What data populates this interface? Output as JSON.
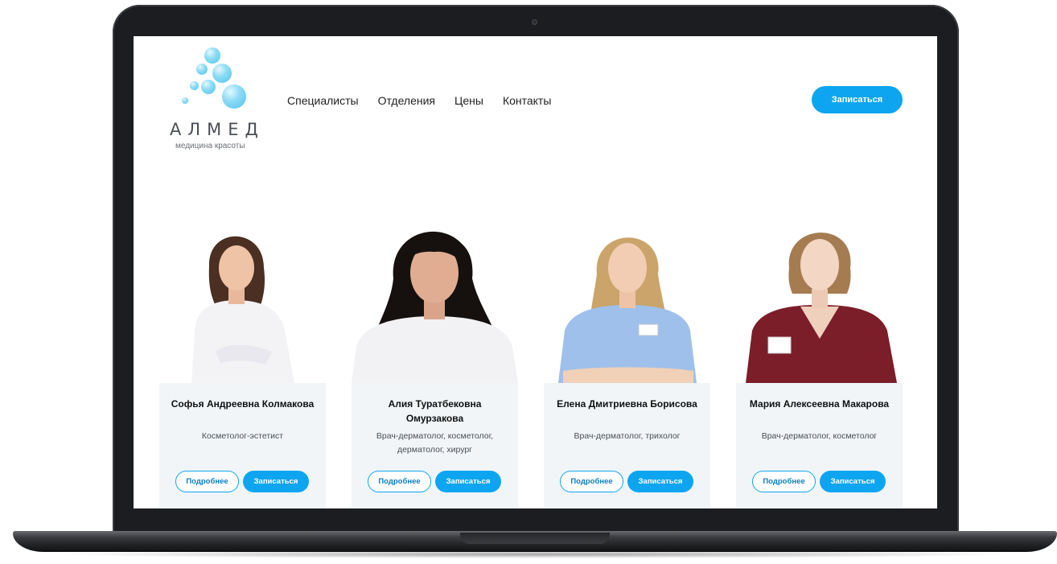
{
  "brand": {
    "name": "АЛМЕД",
    "tagline": "медицина красоты"
  },
  "nav": {
    "items": [
      "Специалисты",
      "Отделения",
      "Цены",
      "Контакты"
    ]
  },
  "header": {
    "cta_label": "Записаться"
  },
  "colors": {
    "accent": "#0ea5f0",
    "card_bg": "#f1f5f8",
    "frame": "#1c1d20"
  },
  "specialists": [
    {
      "name": "Софья Андреевна Колмакова",
      "role": "Косметолог-эстетист",
      "more_label": "Подробнее",
      "book_label": "Записаться"
    },
    {
      "name": "Алия Туратбековна Омурзакова",
      "role": "Врач-дерматолог, косметолог, дерматолог, хирург",
      "more_label": "Подробнее",
      "book_label": "Записаться"
    },
    {
      "name": "Елена Дмитриевна Борисова",
      "role": "Врач-дерматолог, трихолог",
      "more_label": "Подробнее",
      "book_label": "Записаться"
    },
    {
      "name": "Мария Алексеевна Макарова",
      "role": "Врач-дерматолог, косметолог",
      "more_label": "Подробнее",
      "book_label": "Записаться"
    }
  ]
}
